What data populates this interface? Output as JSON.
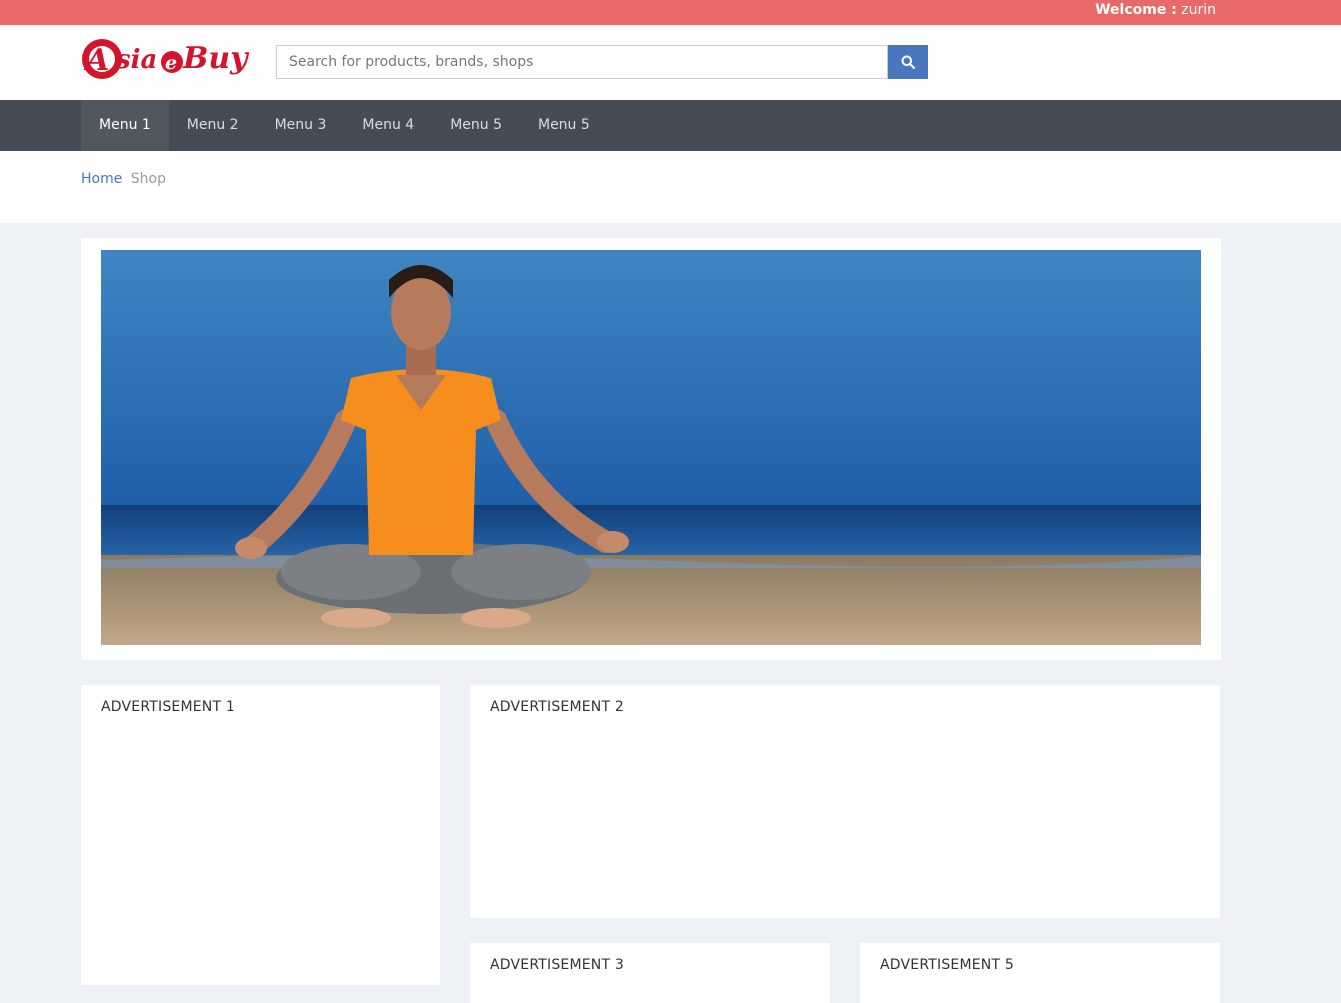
{
  "topbar": {
    "welcome_label": "Welcome :",
    "username": "zurin",
    "color": "#e86968"
  },
  "header": {
    "logo_text": "AsiaeBuy",
    "search": {
      "placeholder": "Search for products, brands, shops",
      "value": "",
      "button_icon": "search-icon"
    },
    "accent": "#4a76be"
  },
  "nav": {
    "items": [
      {
        "label": "Menu 1",
        "active": true
      },
      {
        "label": "Menu 2",
        "active": false
      },
      {
        "label": "Menu 3",
        "active": false
      },
      {
        "label": "Menu 4",
        "active": false
      },
      {
        "label": "Menu 5",
        "active": false
      },
      {
        "label": "Menu 5",
        "active": false
      }
    ],
    "background": "#464c57"
  },
  "breadcrumb": {
    "home": "Home",
    "current": "Shop"
  },
  "banner": {
    "image_subject": "woman meditating on beach"
  },
  "ads": {
    "ad1": "ADVERTISEMENT 1",
    "ad2": "ADVERTISEMENT 2",
    "ad3": "ADVERTISEMENT 3",
    "ad4": "ADVERTISEMENT 5"
  }
}
